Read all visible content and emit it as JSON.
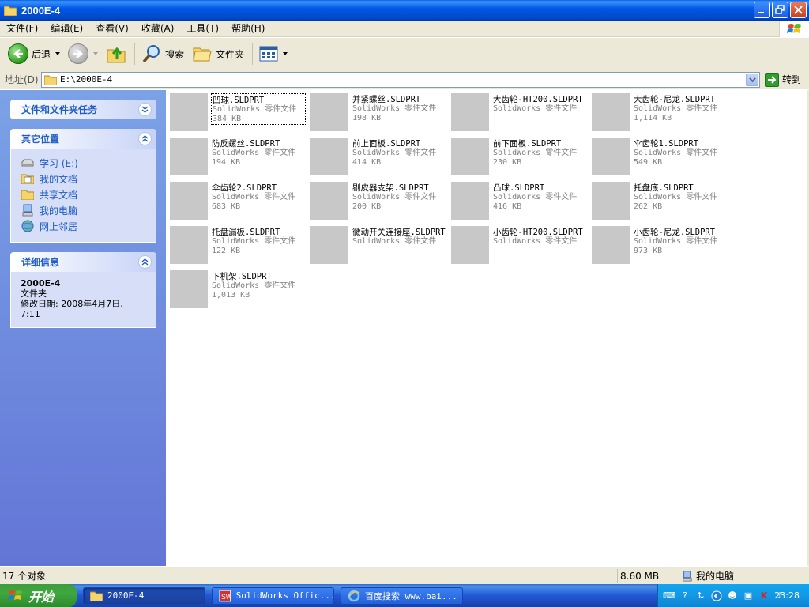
{
  "window": {
    "title": "2000E-4"
  },
  "menu": [
    "文件(F)",
    "编辑(E)",
    "查看(V)",
    "收藏(A)",
    "工具(T)",
    "帮助(H)"
  ],
  "toolbar": {
    "back": "后退",
    "search": "搜索",
    "folders": "文件夹"
  },
  "address": {
    "label": "地址(D)",
    "value": "E:\\2000E-4",
    "go": "转到"
  },
  "left_pane": {
    "tasks_title": "文件和文件夹任务",
    "places_title": "其它位置",
    "places": [
      "学习 (E:)",
      "我的文档",
      "共享文档",
      "我的电脑",
      "网上邻居"
    ],
    "details_title": "详细信息",
    "details": {
      "name": "2000E-4",
      "kind": "文件夹",
      "modified": "修改日期: 2008年4月7日,",
      "modified_time": "7:11"
    }
  },
  "files": [
    {
      "name": "凹球.SLDPRT",
      "type": "SolidWorks 零件文件",
      "size": "384 KB"
    },
    {
      "name": "并紧螺丝.SLDPRT",
      "type": "SolidWorks 零件文件",
      "size": "198 KB"
    },
    {
      "name": "大齿轮-HT200.SLDPRT",
      "type": "SolidWorks 零件文件",
      "size": ""
    },
    {
      "name": "大齿轮-尼龙.SLDPRT",
      "type": "SolidWorks 零件文件",
      "size": "1,114 KB"
    },
    {
      "name": "防反螺丝.SLDPRT",
      "type": "SolidWorks 零件文件",
      "size": "194 KB"
    },
    {
      "name": "前上面板.SLDPRT",
      "type": "SolidWorks 零件文件",
      "size": "414 KB"
    },
    {
      "name": "前下面板.SLDPRT",
      "type": "SolidWorks 零件文件",
      "size": "230 KB"
    },
    {
      "name": "伞齿轮1.SLDPRT",
      "type": "SolidWorks 零件文件",
      "size": "549 KB"
    },
    {
      "name": "伞齿轮2.SLDPRT",
      "type": "SolidWorks 零件文件",
      "size": "683 KB"
    },
    {
      "name": "剔皮器支架.SLDPRT",
      "type": "SolidWorks 零件文件",
      "size": "200 KB"
    },
    {
      "name": "凸球.SLDPRT",
      "type": "SolidWorks 零件文件",
      "size": "416 KB"
    },
    {
      "name": "托盘底.SLDPRT",
      "type": "SolidWorks 零件文件",
      "size": "262 KB"
    },
    {
      "name": "托盘漏板.SLDPRT",
      "type": "SolidWorks 零件文件",
      "size": "122 KB"
    },
    {
      "name": "微动开关连接座.SLDPRT",
      "type": "SolidWorks 零件文件",
      "size": ""
    },
    {
      "name": "小齿轮-HT200.SLDPRT",
      "type": "SolidWorks 零件文件",
      "size": ""
    },
    {
      "name": "小齿轮-尼龙.SLDPRT",
      "type": "SolidWorks 零件文件",
      "size": "973 KB"
    },
    {
      "name": "下机架.SLDPRT",
      "type": "SolidWorks 零件文件",
      "size": "1,013 KB"
    }
  ],
  "status": {
    "count": "17 个对象",
    "size": "8.60 MB",
    "location": "我的电脑"
  },
  "taskbar": {
    "start": "开始",
    "tasks": [
      "2000E-4",
      "SolidWorks Offic...",
      "百度搜索_www.bai..."
    ],
    "clock": "23:28"
  }
}
